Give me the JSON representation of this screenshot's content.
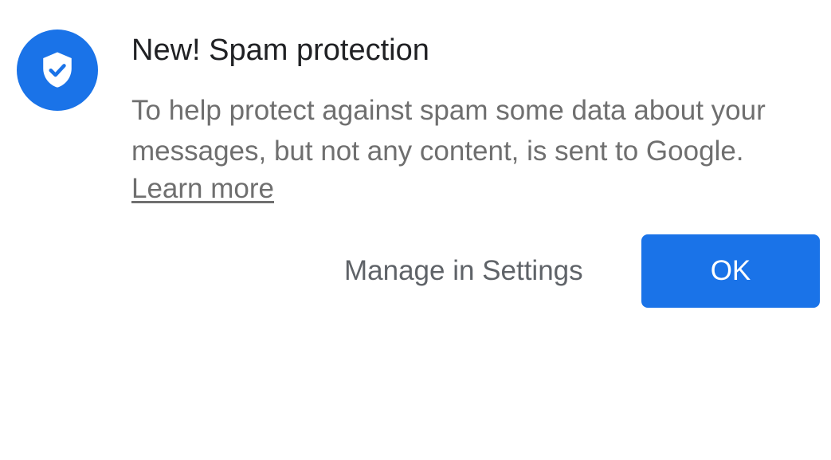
{
  "dialog": {
    "icon": "shield-check-icon",
    "title": "New! Spam protection",
    "body_line_1": "To help protect against spam some data about your",
    "body_line_2": "messages, but not any content, is sent to Google.",
    "learn_more": "Learn more",
    "manage_label": "Manage in Settings",
    "ok_label": "OK"
  },
  "colors": {
    "accent": "#1a73e8",
    "title": "#202124",
    "body": "#6f6f6f",
    "secondary_button": "#5f6368",
    "background": "#ffffff"
  }
}
